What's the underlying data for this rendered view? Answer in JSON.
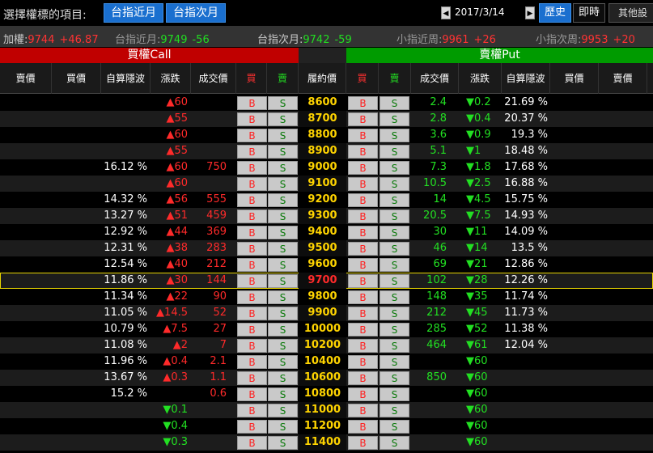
{
  "toolbar": {
    "select_label": "選擇權標的項目:",
    "month1": "台指近月",
    "month2": "台指次月",
    "date": "2017/3/14",
    "history": "歷史",
    "live": "即時",
    "other": "其他設"
  },
  "quotes": [
    {
      "label": "加權:",
      "price": "9744",
      "change": "+46.87",
      "color": "#ff3333",
      "dim": false
    },
    {
      "label": "台指近月:",
      "price": "9749",
      "change": "-56",
      "color": "#22dd22",
      "dim": true
    },
    {
      "label": "台指次月:",
      "price": "9742",
      "change": "-59",
      "color": "#22dd22",
      "dim": false
    },
    {
      "label": "小指近周:",
      "price": "9961",
      "change": "+26",
      "color": "#ff3333",
      "dim": true
    },
    {
      "label": "小指次周:",
      "price": "9953",
      "change": "+20",
      "color": "#ff3333",
      "dim": true
    }
  ],
  "sections": {
    "call": "買權Call",
    "put": "賣權Put"
  },
  "columns": {
    "call_ask": "賣價",
    "call_bid": "買價",
    "call_iv": "自算隱波",
    "call_chg": "漲跌",
    "call_vol": "成交價",
    "call_b": "買",
    "call_s": "賣",
    "strike": "履約價",
    "put_b": "買",
    "put_s": "賣",
    "put_vol": "成交價",
    "put_chg": "漲跌",
    "put_iv": "自算隱波",
    "put_bid": "買價",
    "put_ask": "賣價"
  },
  "buttons": {
    "buy": "B",
    "sell": "S"
  },
  "rows": [
    {
      "strike": "8600",
      "call_iv": "",
      "call_chg": "▲60",
      "call_vol": "",
      "put_vol": "2.4",
      "put_chg": "▼0.2",
      "put_iv": "21.69 %"
    },
    {
      "strike": "8700",
      "call_iv": "",
      "call_chg": "▲55",
      "call_vol": "",
      "put_vol": "2.8",
      "put_chg": "▼0.4",
      "put_iv": "20.37 %"
    },
    {
      "strike": "8800",
      "call_iv": "",
      "call_chg": "▲60",
      "call_vol": "",
      "put_vol": "3.6",
      "put_chg": "▼0.9",
      "put_iv": "19.3 %"
    },
    {
      "strike": "8900",
      "call_iv": "",
      "call_chg": "▲55",
      "call_vol": "",
      "put_vol": "5.1",
      "put_chg": "▼1",
      "put_iv": "18.48 %"
    },
    {
      "strike": "9000",
      "call_iv": "16.12 %",
      "call_chg": "▲60",
      "call_vol": "750",
      "put_vol": "7.3",
      "put_chg": "▼1.8",
      "put_iv": "17.68 %"
    },
    {
      "strike": "9100",
      "call_iv": "",
      "call_chg": "▲60",
      "call_vol": "",
      "put_vol": "10.5",
      "put_chg": "▼2.5",
      "put_iv": "16.88 %"
    },
    {
      "strike": "9200",
      "call_iv": "14.32 %",
      "call_chg": "▲56",
      "call_vol": "555",
      "put_vol": "14",
      "put_chg": "▼4.5",
      "put_iv": "15.75 %"
    },
    {
      "strike": "9300",
      "call_iv": "13.27 %",
      "call_chg": "▲51",
      "call_vol": "459",
      "put_vol": "20.5",
      "put_chg": "▼7.5",
      "put_iv": "14.93 %"
    },
    {
      "strike": "9400",
      "call_iv": "12.92 %",
      "call_chg": "▲44",
      "call_vol": "369",
      "put_vol": "30",
      "put_chg": "▼11",
      "put_iv": "14.09 %"
    },
    {
      "strike": "9500",
      "call_iv": "12.31 %",
      "call_chg": "▲38",
      "call_vol": "283",
      "put_vol": "46",
      "put_chg": "▼14",
      "put_iv": "13.5 %"
    },
    {
      "strike": "9600",
      "call_iv": "12.54 %",
      "call_chg": "▲40",
      "call_vol": "212",
      "put_vol": "69",
      "put_chg": "▼21",
      "put_iv": "12.86 %"
    },
    {
      "strike": "9700",
      "call_iv": "11.86 %",
      "call_chg": "▲30",
      "call_vol": "144",
      "put_vol": "102",
      "put_chg": "▼28",
      "put_iv": "12.26 %",
      "atm": true
    },
    {
      "strike": "9800",
      "call_iv": "11.34 %",
      "call_chg": "▲22",
      "call_vol": "90",
      "put_vol": "148",
      "put_chg": "▼35",
      "put_iv": "11.74 %"
    },
    {
      "strike": "9900",
      "call_iv": "11.05 %",
      "call_chg": "▲14.5",
      "call_vol": "52",
      "put_vol": "212",
      "put_chg": "▼45",
      "put_iv": "11.73 %"
    },
    {
      "strike": "10000",
      "call_iv": "10.79 %",
      "call_chg": "▲7.5",
      "call_vol": "27",
      "put_vol": "285",
      "put_chg": "▼52",
      "put_iv": "11.38 %"
    },
    {
      "strike": "10200",
      "call_iv": "11.08 %",
      "call_chg": "▲2",
      "call_vol": "7",
      "put_vol": "464",
      "put_chg": "▼61",
      "put_iv": "12.04 %"
    },
    {
      "strike": "10400",
      "call_iv": "11.96 %",
      "call_chg": "▲0.4",
      "call_vol": "2.1",
      "put_vol": "",
      "put_chg": "▼60",
      "put_iv": ""
    },
    {
      "strike": "10600",
      "call_iv": "13.67 %",
      "call_chg": "▲0.3",
      "call_vol": "1.1",
      "put_vol": "850",
      "put_chg": "▼60",
      "put_iv": ""
    },
    {
      "strike": "10800",
      "call_iv": "15.2 %",
      "call_chg": "",
      "call_vol": "0.6",
      "put_vol": "",
      "put_chg": "▼60",
      "put_iv": ""
    },
    {
      "strike": "11000",
      "call_iv": "",
      "call_chg": "▼0.1",
      "call_vol": "",
      "put_vol": "",
      "put_chg": "▼60",
      "put_iv": ""
    },
    {
      "strike": "11200",
      "call_iv": "",
      "call_chg": "▼0.4",
      "call_vol": "",
      "put_vol": "",
      "put_chg": "▼60",
      "put_iv": ""
    },
    {
      "strike": "11400",
      "call_iv": "",
      "call_chg": "▼0.3",
      "call_vol": "",
      "put_vol": "",
      "put_chg": "▼60",
      "put_iv": ""
    }
  ]
}
